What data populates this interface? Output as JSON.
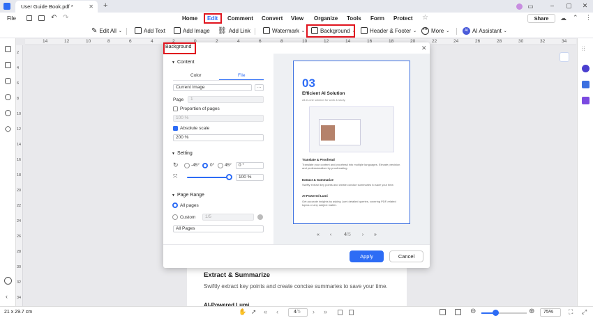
{
  "window": {
    "tab_title": "User Guide Book.pdf *",
    "new_tab": "+"
  },
  "menubar": {
    "file": "File",
    "items": [
      "Home",
      "Edit",
      "Comment",
      "Convert",
      "View",
      "Organize",
      "Tools",
      "Form",
      "Protect"
    ],
    "share": "Share"
  },
  "toolbar": {
    "edit_all": "Edit All",
    "add_text": "Add Text",
    "add_image": "Add Image",
    "add_link": "Add Link",
    "watermark": "Watermark",
    "background": "Background",
    "header_footer": "Header & Footer",
    "more": "More",
    "ai_assistant": "AI Assistant"
  },
  "ruler": {
    "numbers": [
      "14",
      "12",
      "10",
      "8",
      "6",
      "4",
      "2",
      "0",
      "2",
      "4",
      "6",
      "8",
      "10",
      "12",
      "14",
      "16",
      "18",
      "20",
      "22",
      "24",
      "26",
      "28",
      "30",
      "32",
      "34"
    ],
    "vnumbers": [
      "2",
      "4",
      "6",
      "8",
      "10",
      "12",
      "14",
      "16",
      "18",
      "20",
      "22",
      "24",
      "26",
      "28",
      "30",
      "32",
      "34"
    ]
  },
  "dialog": {
    "title": "Background",
    "content_label": "Content",
    "tab_color": "Color",
    "tab_file": "File",
    "file_value": "Current Image",
    "browse": "···",
    "page_label": "Page",
    "page_value": "1",
    "proportion_label": "Proportion of pages",
    "proportion_value": "100 %",
    "absolute_label": "Absolute scale",
    "absolute_value": "200 %",
    "setting_label": "Setting",
    "rot_neg45": "-45°",
    "rot_0": "0°",
    "rot_45": "45°",
    "rot_value": "0 °",
    "opacity_value": "100 %",
    "page_range_label": "Page Range",
    "all_pages": "All pages",
    "custom": "Custom",
    "custom_value": "1/5",
    "range_select": "All Pages",
    "apply": "Apply",
    "cancel": "Cancel",
    "preview": {
      "number": "03",
      "heading": "Efficient AI Solution",
      "sub": "All-in-one solution for work & study.",
      "s1_title": "Translate & Proofread",
      "s1_text": "Translate your content and proofread into multiple languages. Elevate precision and professionalism by proofreading.",
      "s2_title": "Extract & Summarize",
      "s2_text": "Swiftly extract key points and create concise summaries to save your time.",
      "s3_title": "AI-Powered Lumi",
      "s3_text": "Get accurate insights by asking Lumi detailed queries, covering PDF-related topics or any subject matter."
    },
    "pager": {
      "first": "«",
      "prev": "‹",
      "page": "4",
      "total": "/5",
      "next": "›",
      "last": "»"
    }
  },
  "page": {
    "heading": "Extract & Summarize",
    "text": "Swiftly extract key points and create concise summaries to save your time.",
    "partial": "AI-Powered Lumi"
  },
  "statusbar": {
    "size": "21 x 29.7 cm",
    "page": "4",
    "total": "/5",
    "zoom": "75%"
  },
  "colors": {
    "accent": "#2d6cf5",
    "highlight_red": "#e0141e"
  }
}
